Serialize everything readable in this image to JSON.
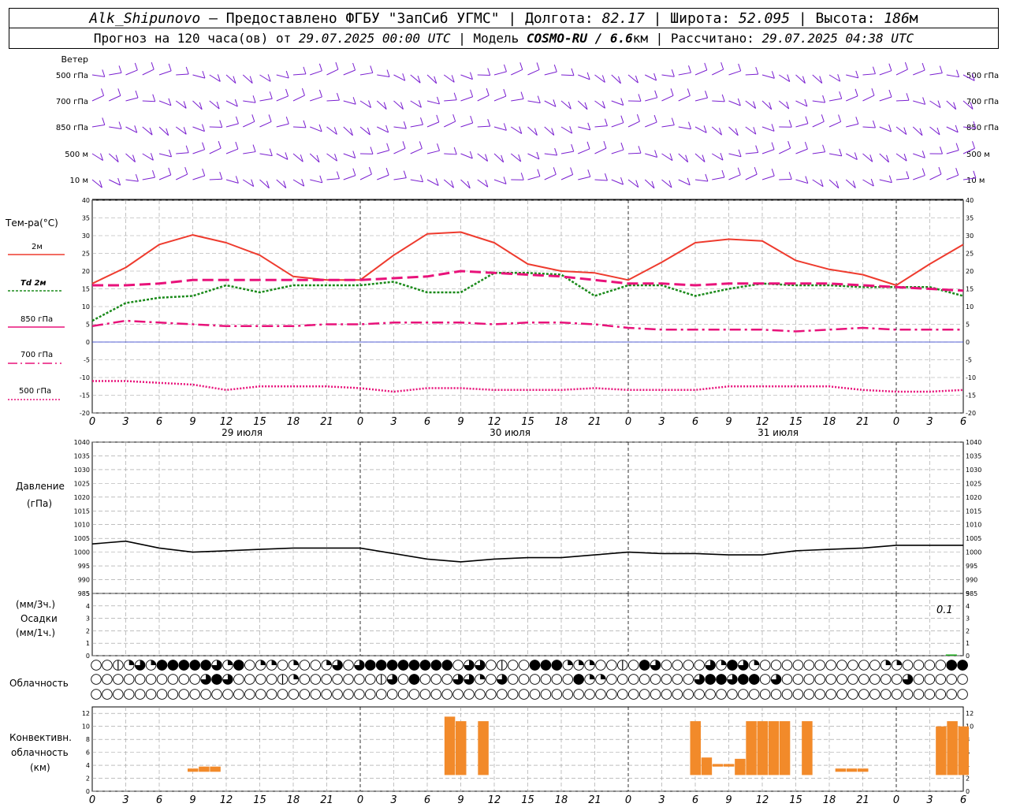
{
  "header": {
    "station": "Alk_Shipunovo",
    "provider": " – Предоставлено ФГБУ \"ЗапСиб УГМС\" | Долгота: ",
    "lon": "82.17",
    "sep_lat": " | Широта: ",
    "lat": "52.095",
    "sep_alt": " | Высота: ",
    "alt": "186",
    "alt_unit": "м",
    "forecast_prefix": "Прогноз на 120 часа(ов) от ",
    "forecast_time": "29.07.2025 00:00 UTC",
    "model_prefix": "  | Модель ",
    "model": "COSMO-RU / 6.6",
    "model_unit": "км",
    "calc_prefix": " | Рассчитано: ",
    "calc_time": "29.07.2025 04:38 UTC"
  },
  "x_ticks": [
    "0",
    "3",
    "6",
    "9",
    "12",
    "15",
    "18",
    "21",
    "0",
    "3",
    "6",
    "9",
    "12",
    "15",
    "18",
    "21",
    "0",
    "3",
    "6",
    "9",
    "12",
    "15",
    "18",
    "21",
    "0",
    "3",
    "6"
  ],
  "dates": [
    "29 июля",
    "30 июля",
    "31 июля"
  ],
  "wind": {
    "title": "Ветер",
    "levels": [
      "500 гПа",
      "700 гПа",
      "850 гПа",
      "500 м",
      "10 м"
    ],
    "color": "#7a1fd0"
  },
  "colors": {
    "t2m": "#ee3b2e",
    "td2m": "#1a8a1a",
    "upper": "#e8127a",
    "zero": "#2233cc",
    "pressure": "#000000",
    "precip": "#22aa22",
    "conv": "#f28a2a"
  },
  "chart_data": [
    {
      "type": "line",
      "title": "Тем-ра(°C)",
      "ylim": [
        -20,
        40
      ],
      "yticks": [
        40,
        35,
        30,
        25,
        20,
        15,
        10,
        5,
        0,
        -5,
        -10,
        -15,
        -20
      ],
      "x_hours": [
        0,
        3,
        6,
        9,
        12,
        15,
        18,
        21,
        24,
        27,
        30,
        33,
        36,
        39,
        42,
        45,
        48,
        51,
        54,
        57,
        60,
        63,
        66,
        69,
        72,
        75,
        78
      ],
      "series": [
        {
          "name": "2м",
          "values": [
            16.5,
            21,
            27.5,
            30.2,
            28,
            24.5,
            18.5,
            17.5,
            17.5,
            24.5,
            30.5,
            31,
            28,
            22,
            20,
            19.5,
            17.5,
            22.5,
            28,
            29,
            28.5,
            23,
            20.5,
            19,
            16,
            22,
            27.5
          ]
        },
        {
          "name": "Td 2м",
          "values": [
            6,
            11,
            12.5,
            13,
            16,
            14,
            16,
            16,
            16,
            17,
            14,
            14,
            19.5,
            19.5,
            19,
            13,
            16,
            16,
            13,
            15,
            16.5,
            16,
            16,
            15.5,
            15.5,
            15.5,
            13
          ]
        },
        {
          "name": "850 гПа",
          "values": [
            16,
            16,
            16.5,
            17.5,
            17.5,
            17.5,
            17.5,
            17.5,
            17.5,
            18,
            18.5,
            20,
            19.5,
            19,
            18.5,
            17.5,
            16.5,
            16.5,
            16,
            16.5,
            16.5,
            16.5,
            16.5,
            16,
            15.5,
            15,
            14.5
          ]
        },
        {
          "name": "700 гПа",
          "values": [
            4.5,
            6,
            5.5,
            5,
            4.5,
            4.5,
            4.5,
            5,
            5,
            5.5,
            5.5,
            5.5,
            5,
            5.5,
            5.5,
            5,
            4,
            3.5,
            3.5,
            3.5,
            3.5,
            3,
            3.5,
            4,
            3.5,
            3.5,
            3.5
          ]
        },
        {
          "name": "500 гПа",
          "values": [
            -11,
            -11,
            -11.5,
            -12,
            -13.5,
            -12.5,
            -12.5,
            -12.5,
            -13,
            -14,
            -13,
            -13,
            -13.5,
            -13.5,
            -13.5,
            -13,
            -13.5,
            -13.5,
            -13.5,
            -12.5,
            -12.5,
            -12.5,
            -12.5,
            -13.5,
            -14,
            -14,
            -13.5
          ]
        }
      ]
    },
    {
      "type": "line",
      "title": "Давление",
      "ylabel": "(гПа)",
      "ylim": [
        985,
        1040
      ],
      "yticks": [
        1040,
        1035,
        1030,
        1025,
        1020,
        1015,
        1010,
        1005,
        1000,
        995,
        990,
        985
      ],
      "x_hours": [
        0,
        3,
        6,
        9,
        12,
        15,
        18,
        21,
        24,
        27,
        30,
        33,
        36,
        39,
        42,
        45,
        48,
        51,
        54,
        57,
        60,
        63,
        66,
        69,
        72,
        75,
        78
      ],
      "series": [
        {
          "name": "Давление",
          "values": [
            1003,
            1004,
            1001.5,
            1000,
            1000.5,
            1001,
            1001.5,
            1001.5,
            1001.5,
            999.5,
            997.5,
            996.5,
            997.5,
            998,
            998,
            999,
            1000,
            999.5,
            999.5,
            999,
            999,
            1000.5,
            1001,
            1001.5,
            1002.5,
            1002.5,
            1002.5
          ]
        }
      ]
    },
    {
      "type": "bar",
      "title": "Осадки",
      "ylabel_top": "(мм/3ч.)",
      "ylabel_bottom": "(мм/1ч.)",
      "ylim": [
        0,
        5
      ],
      "yticks": [
        5,
        4,
        3,
        2,
        1,
        0
      ],
      "annotation": "0.1",
      "bars": [
        {
          "hour": 77,
          "value": 0.1
        }
      ]
    },
    {
      "type": "bar",
      "title": "Конвективн. облачность (км)",
      "ylim": [
        0,
        13
      ],
      "yticks": [
        12,
        10,
        8,
        6,
        4,
        2,
        0
      ],
      "bars": [
        {
          "hour": 9,
          "base": 3,
          "top": 3.5
        },
        {
          "hour": 10,
          "base": 3,
          "top": 3.8
        },
        {
          "hour": 11,
          "base": 3,
          "top": 3.8
        },
        {
          "hour": 32,
          "base": 2.5,
          "top": 11.5
        },
        {
          "hour": 33,
          "base": 2.5,
          "top": 10.8
        },
        {
          "hour": 35,
          "base": 2.5,
          "top": 10.8
        },
        {
          "hour": 54,
          "base": 2.5,
          "top": 10.8
        },
        {
          "hour": 55,
          "base": 2.5,
          "top": 5.2
        },
        {
          "hour": 56,
          "base": 3.8,
          "top": 4.2
        },
        {
          "hour": 57,
          "base": 3.8,
          "top": 4.2
        },
        {
          "hour": 58,
          "base": 2.5,
          "top": 5
        },
        {
          "hour": 59,
          "base": 2.5,
          "top": 10.8
        },
        {
          "hour": 60,
          "base": 2.5,
          "top": 10.8
        },
        {
          "hour": 61,
          "base": 2.5,
          "top": 10.8
        },
        {
          "hour": 62,
          "base": 2.5,
          "top": 10.8
        },
        {
          "hour": 64,
          "base": 2.5,
          "top": 10.8
        },
        {
          "hour": 67,
          "base": 3,
          "top": 3.5
        },
        {
          "hour": 68,
          "base": 3,
          "top": 3.5
        },
        {
          "hour": 69,
          "base": 3,
          "top": 3.5
        },
        {
          "hour": 76,
          "base": 2.5,
          "top": 10
        },
        {
          "hour": 77,
          "base": 2.5,
          "top": 10.8
        },
        {
          "hour": 78,
          "base": 2.5,
          "top": 10
        }
      ]
    }
  ],
  "cloud": {
    "title": "Облачность",
    "rows": [
      [
        0,
        0,
        1,
        2,
        3,
        2,
        4,
        4,
        4,
        4,
        4,
        3,
        2,
        4,
        0,
        2,
        2,
        0,
        2,
        0,
        0,
        2,
        3,
        0,
        3,
        4,
        4,
        4,
        4,
        4,
        4,
        4,
        4,
        0,
        3,
        3,
        0,
        1,
        0,
        0,
        4,
        4,
        4,
        2,
        2,
        2,
        0,
        0,
        1,
        0,
        4,
        3,
        0,
        0,
        0,
        0,
        3,
        2,
        4,
        3,
        2,
        0,
        0,
        0,
        0,
        0,
        0,
        0,
        0,
        0,
        0,
        0,
        2,
        2,
        0,
        0,
        0,
        0,
        4,
        4
      ],
      [
        0,
        0,
        0,
        0,
        0,
        0,
        0,
        0,
        0,
        0,
        3,
        4,
        3,
        0,
        0,
        0,
        0,
        1,
        2,
        0,
        0,
        0,
        0,
        0,
        0,
        0,
        1,
        3,
        0,
        4,
        0,
        0,
        0,
        3,
        3,
        2,
        0,
        3,
        0,
        0,
        0,
        0,
        0,
        0,
        4,
        2,
        2,
        0,
        0,
        0,
        0,
        0,
        0,
        0,
        0,
        3,
        4,
        4,
        3,
        4,
        4,
        0,
        3,
        0,
        0,
        0,
        0,
        0,
        0,
        0,
        0,
        0,
        0,
        0,
        3,
        0,
        0,
        0,
        0,
        0
      ],
      [
        0,
        0,
        0,
        0,
        0,
        0,
        0,
        0,
        0,
        0,
        0,
        0,
        0,
        0,
        0,
        0,
        0,
        0,
        0,
        0,
        0,
        0,
        0,
        0,
        0,
        0,
        0,
        0,
        0,
        0,
        0,
        0,
        0,
        0,
        0,
        0,
        0,
        0,
        0,
        0,
        0,
        0,
        0,
        0,
        0,
        0,
        0,
        0,
        0,
        0,
        0,
        0,
        0,
        0,
        0,
        0,
        0,
        0,
        0,
        0,
        0,
        0,
        0,
        0,
        0,
        0,
        0,
        0,
        0,
        0,
        0,
        0,
        0,
        0,
        0,
        0,
        0,
        0,
        0,
        0
      ]
    ]
  }
}
